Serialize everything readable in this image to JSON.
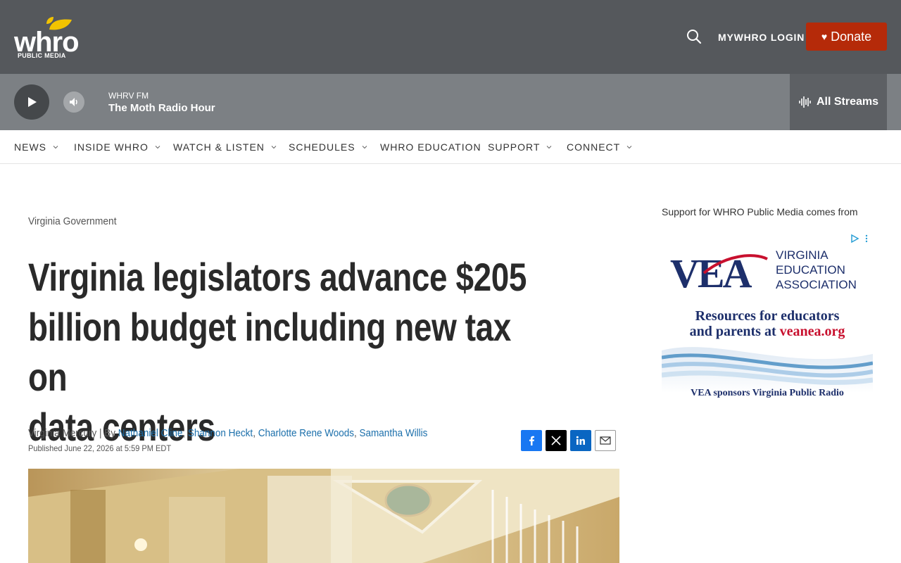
{
  "header": {
    "logo_word": "whro",
    "logo_sub": "PUBLIC MEDIA",
    "login_label": "MYWHRO LOGIN",
    "donate_label": "Donate",
    "brand_color": "#55585c",
    "donate_color": "#b52a09"
  },
  "player": {
    "station": "WHRV FM",
    "program": "The Moth Radio Hour",
    "streams_label": "All Streams"
  },
  "nav": {
    "items": [
      {
        "label": "NEWS",
        "dropdown": true
      },
      {
        "label": "INSIDE WHRO",
        "dropdown": true
      },
      {
        "label": "WATCH & LISTEN",
        "dropdown": true
      },
      {
        "label": "SCHEDULES",
        "dropdown": true
      },
      {
        "label": "WHRO EDUCATION",
        "dropdown": false
      },
      {
        "label": "SUPPORT",
        "dropdown": true
      },
      {
        "label": "CONNECT",
        "dropdown": true
      }
    ]
  },
  "article": {
    "kicker": "Virginia Government",
    "headline_lines": [
      "Virginia legislators advance $205",
      "billion budget including new tax on",
      "data centers"
    ],
    "source": "Virginia Mercury | By ",
    "authors": [
      "Nathaniel Cline",
      "Shannon Heckt",
      "Charlotte Rene Woods",
      "Samantha Willis"
    ],
    "author_sep": ", ",
    "published": "Published June 22, 2026 at 5:59 PM EDT"
  },
  "share": {
    "icons": [
      "facebook-icon",
      "x-icon",
      "linkedin-icon",
      "email-icon"
    ]
  },
  "sidebar": {
    "sponsor_label": "Support for WHRO Public Media comes from",
    "ad": {
      "brand": "VEA",
      "org_lines": [
        "VIRGINIA",
        "EDUCATION",
        "ASSOCIATION"
      ],
      "tagline_1": "Resources for educators",
      "tagline_2a": "and parents at ",
      "tagline_2b": "veanea.org",
      "footer": "VEA sponsors Virginia Public Radio"
    }
  }
}
